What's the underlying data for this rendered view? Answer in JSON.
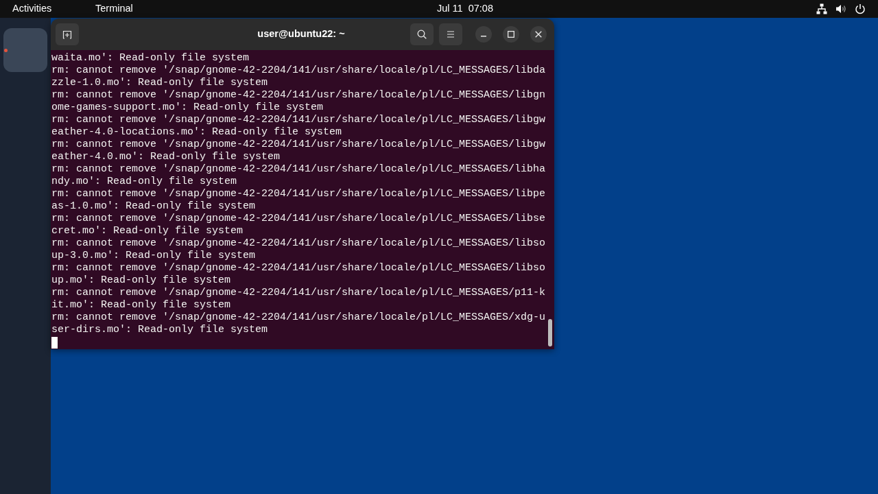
{
  "top_bar": {
    "activities": "Activities",
    "app_menu": "Terminal",
    "clock": "Jul 11  07:08"
  },
  "dock": {
    "items": [
      {
        "running": true
      }
    ]
  },
  "terminal": {
    "title": "user@ubuntu22: ~",
    "lines": [
      "waita.mo': Read-only file system",
      "rm: cannot remove '/snap/gnome-42-2204/141/usr/share/locale/pl/LC_MESSAGES/libda",
      "zzle-1.0.mo': Read-only file system",
      "rm: cannot remove '/snap/gnome-42-2204/141/usr/share/locale/pl/LC_MESSAGES/libgn",
      "ome-games-support.mo': Read-only file system",
      "rm: cannot remove '/snap/gnome-42-2204/141/usr/share/locale/pl/LC_MESSAGES/libgw",
      "eather-4.0-locations.mo': Read-only file system",
      "rm: cannot remove '/snap/gnome-42-2204/141/usr/share/locale/pl/LC_MESSAGES/libgw",
      "eather-4.0.mo': Read-only file system",
      "rm: cannot remove '/snap/gnome-42-2204/141/usr/share/locale/pl/LC_MESSAGES/libha",
      "ndy.mo': Read-only file system",
      "rm: cannot remove '/snap/gnome-42-2204/141/usr/share/locale/pl/LC_MESSAGES/libpe",
      "as-1.0.mo': Read-only file system",
      "rm: cannot remove '/snap/gnome-42-2204/141/usr/share/locale/pl/LC_MESSAGES/libse",
      "cret.mo': Read-only file system",
      "rm: cannot remove '/snap/gnome-42-2204/141/usr/share/locale/pl/LC_MESSAGES/libso",
      "up-3.0.mo': Read-only file system",
      "rm: cannot remove '/snap/gnome-42-2204/141/usr/share/locale/pl/LC_MESSAGES/libso",
      "up.mo': Read-only file system",
      "rm: cannot remove '/snap/gnome-42-2204/141/usr/share/locale/pl/LC_MESSAGES/p11-k",
      "it.mo': Read-only file system",
      "rm: cannot remove '/snap/gnome-42-2204/141/usr/share/locale/pl/LC_MESSAGES/xdg-u",
      "ser-dirs.mo': Read-only file system"
    ]
  }
}
